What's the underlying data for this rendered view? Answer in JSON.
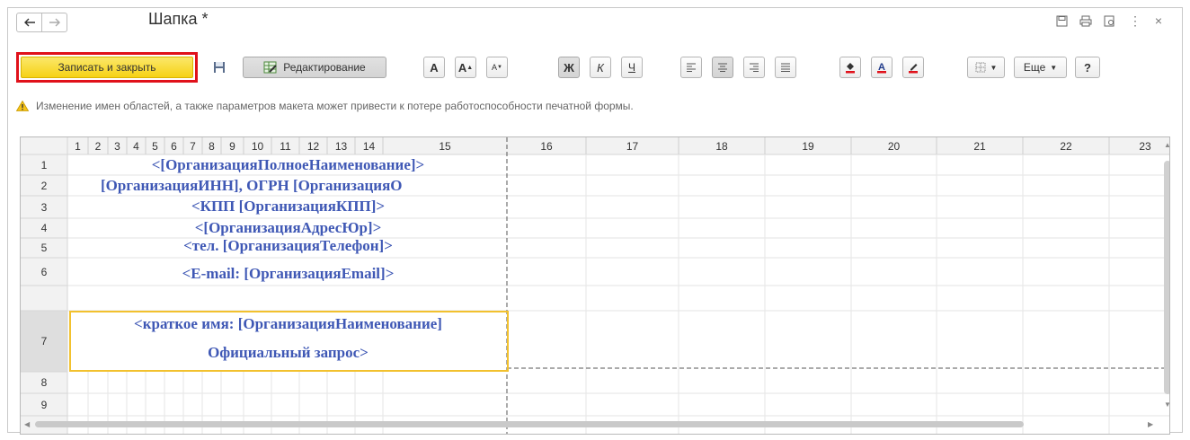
{
  "window": {
    "title": "Шапка *",
    "controls": [
      "disk-icon",
      "printer-icon",
      "preview-icon",
      "more-vertical-icon",
      "close-icon"
    ],
    "more_label": "⋮",
    "close_label": "×"
  },
  "toolbar": {
    "save_close_label": "Записать и закрыть",
    "edit_label": "Редактирование",
    "font_a": "A",
    "font_grow": "A",
    "font_shrink": "A",
    "bold": "Ж",
    "italic": "К",
    "underline": "Ч",
    "more_label": "Еще",
    "help_label": "?",
    "colors": {
      "save_close_bg": "#f6d215",
      "save_close_highlight": "#e0111a",
      "fill_color": "#e0111a",
      "text_color": "#e0111a",
      "border_color": "#e0111a"
    }
  },
  "warning": {
    "text": "Изменение имен областей, а также параметров макета может привести к потере работоспособности печатной формы."
  },
  "sheet": {
    "narrow_columns": [
      "1",
      "2",
      "3",
      "4",
      "5",
      "6",
      "7",
      "8",
      "9",
      "10",
      "11",
      "12",
      "13",
      "14",
      "15"
    ],
    "wide_columns": [
      "16",
      "17",
      "18",
      "19",
      "20",
      "21",
      "22",
      "23"
    ],
    "rows": [
      "1",
      "2",
      "3",
      "4",
      "5",
      "6",
      "7",
      "8",
      "9"
    ],
    "cells": [
      "<[ОрганизацияПолноеНаименование]>",
      "[ОрганизацияИНН], ОГРН [ОрганизацияО",
      "<КПП [ОрганизацияКПП]>",
      "<[ОрганизацияАдресЮр]>",
      "<тел. [ОрганизацияТелефон]>",
      "<E-mail: [ОрганизацияEmail]>",
      "<краткое имя: [ОрганизацияНаименование]",
      "Официальный запрос>"
    ],
    "text_color": "#3f58b5",
    "selection_color": "#f2c12e"
  }
}
